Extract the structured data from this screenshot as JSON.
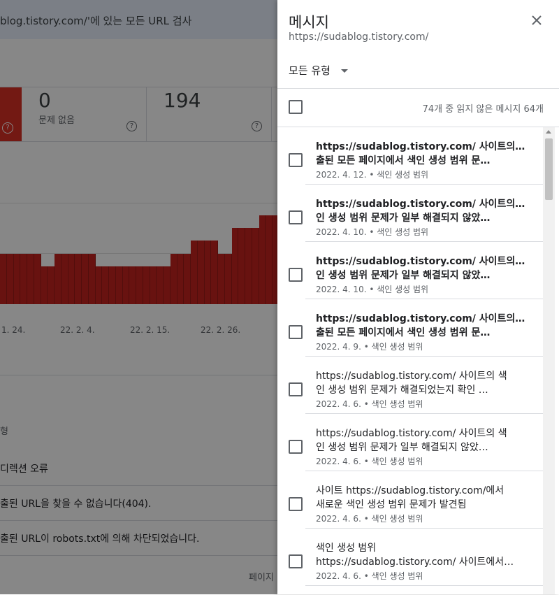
{
  "background": {
    "search_text": "blog.tistory.com/'에 있는 모든 URL 검사",
    "summary": [
      {
        "value": "0",
        "label": "문제 없음"
      },
      {
        "value": "194",
        "label": ""
      }
    ],
    "x_ticks": [
      "1. 24.",
      "22. 2. 4.",
      "22. 2. 15.",
      "22. 2. 26."
    ],
    "table_header": "형",
    "rows": [
      "디렉션 오류",
      "출된 URL을 찾을 수 없습니다(404).",
      "출된 URL이 robots.txt에 의해 차단되었습니다."
    ],
    "page_label": "페이지"
  },
  "chart_data": {
    "type": "bar",
    "values": [
      4,
      4,
      4,
      4,
      4,
      4,
      3,
      3,
      4,
      4,
      4,
      4,
      4,
      4,
      3,
      3,
      3,
      3,
      3,
      3,
      3,
      3,
      3,
      3,
      3,
      4,
      4,
      4,
      5,
      5,
      5,
      5,
      4,
      4,
      6,
      6,
      6,
      6,
      7,
      7,
      7
    ],
    "series_color": "#c5221f"
  },
  "panel": {
    "title": "메시지",
    "subtitle": "https://sudablog.tistory.com/",
    "filter_label": "모든 유형",
    "unread_summary": "74개 중 읽지 않은 메시지 64개",
    "messages": [
      {
        "line1": "https://sudablog.tistory.com/ 사이트의 제",
        "line2": "출된 모든 페이지에서 색인 생성 범위 문…",
        "meta": "2022. 4. 12. • 색인 생성 범위",
        "unread": true
      },
      {
        "line1": "https://sudablog.tistory.com/ 사이트의 색",
        "line2": "인 생성 범위 문제가 일부 해결되지 않았…",
        "meta": "2022. 4. 10. • 색인 생성 범위",
        "unread": true
      },
      {
        "line1": "https://sudablog.tistory.com/ 사이트의 색",
        "line2": "인 생성 범위 문제가 일부 해결되지 않았…",
        "meta": "2022. 4. 10. • 색인 생성 범위",
        "unread": true
      },
      {
        "line1": "https://sudablog.tistory.com/ 사이트의 제",
        "line2": "출된 모든 페이지에서 색인 생성 범위 문…",
        "meta": "2022. 4. 9. • 색인 생성 범위",
        "unread": true
      },
      {
        "line1": "https://sudablog.tistory.com/ 사이트의 색",
        "line2": "인 생성 범위 문제가 해결되었는지 확인 …",
        "meta": "2022. 4. 6. • 색인 생성 범위",
        "unread": false
      },
      {
        "line1": "https://sudablog.tistory.com/ 사이트의 색",
        "line2": "인 생성 범위 문제가 일부 해결되지 않았…",
        "meta": "2022. 4. 6. • 색인 생성 범위",
        "unread": false
      },
      {
        "line1": "사이트 https://sudablog.tistory.com/에서",
        "line2": "새로운 색인 생성 범위 문제가 발견됨",
        "meta": "2022. 4. 6. • 색인 생성 범위",
        "unread": false
      },
      {
        "line1": "색인 생성 범위",
        "line2": "https://sudablog.tistory.com/ 사이트에서…",
        "meta": "2022. 4. 6. • 색인 생성 범위",
        "unread": false
      }
    ]
  },
  "icons": {
    "close": "close-icon",
    "dropdown": "chevron-down-icon",
    "help": "help-circle-icon"
  }
}
